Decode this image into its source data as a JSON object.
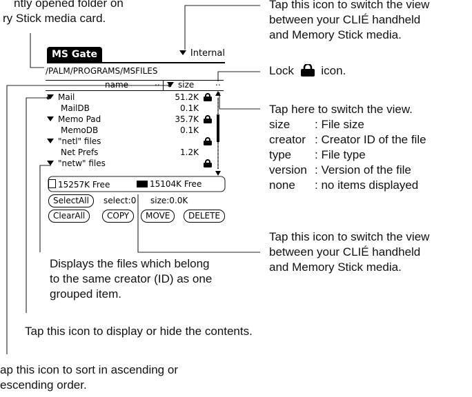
{
  "device": {
    "app_title": "MS Gate",
    "location": "Internal",
    "path": "/PALM/PROGRAMS/MSFILES",
    "columns": {
      "name": "name",
      "name_sort": "..",
      "size": "size",
      "size_sort": ".."
    },
    "rows": [
      {
        "name": "Mail",
        "size": "51.2K",
        "lock": true
      },
      {
        "name": "MailDB",
        "size": "0.1K",
        "lock": false
      },
      {
        "name": "Memo Pad",
        "size": "35.7K",
        "lock": true
      },
      {
        "name": "MemoDB",
        "size": "0.1K",
        "lock": false
      },
      {
        "name": "\"netl\" files",
        "size": "",
        "lock": true
      },
      {
        "name": "Net Prefs",
        "size": "1.2K",
        "lock": false
      },
      {
        "name": "\"netw\" files",
        "size": "",
        "lock": true
      }
    ],
    "media": {
      "memory_stick_free": "15257K Free",
      "handheld_free": "15104K Free"
    },
    "buttons": {
      "select_all": "SelectAll",
      "select_count": "select:0",
      "selected_size": "size:0.0K",
      "clear_all": "ClearAll",
      "copy": "COPY",
      "move": "MOVE",
      "delete": "DELETE"
    }
  },
  "annotations": {
    "folder": [
      "ntly opened folder on",
      "ry Stick media card."
    ],
    "switch_top": [
      "Tap this icon to switch the view",
      "between your CLIÉ handheld",
      "and Memory Stick media."
    ],
    "lock_prefix": "Lock",
    "lock_suffix": "icon.",
    "switch_view": "Tap here to switch the view.",
    "view_options": [
      {
        "key": "size",
        "desc": ": File size"
      },
      {
        "key": "creator",
        "desc": ": Creator ID of the file"
      },
      {
        "key": "type",
        "desc": ": File type"
      },
      {
        "key": "version",
        "desc": ": Version of the file"
      },
      {
        "key": "none",
        "desc": ": no items displayed"
      }
    ],
    "switch_bottom": [
      "Tap this icon to switch the view",
      "between your CLIÉ handheld",
      "and Memory Stick media."
    ],
    "group": [
      "Displays the files which belong",
      "to the same creator (ID) as one",
      "grouped item."
    ],
    "expand": "Tap this icon to display or hide the contents.",
    "sort": [
      "ap this icon to sort in ascending or",
      "escending order."
    ]
  },
  "colors": {
    "ink": "#000000",
    "background": "#ffffff"
  }
}
